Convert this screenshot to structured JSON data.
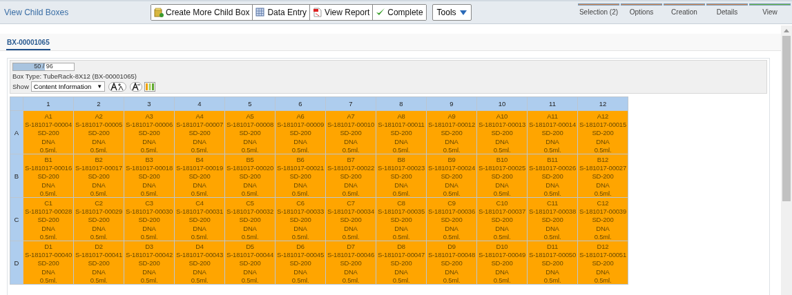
{
  "header": {
    "title": "View Child Boxes",
    "toolbar": [
      {
        "kind": "create",
        "label": "Create More Child Box"
      },
      {
        "kind": "entry",
        "label": "Data Entry"
      },
      {
        "kind": "report",
        "label": "View Report"
      },
      {
        "kind": "complete",
        "label": "Complete"
      }
    ],
    "tools": {
      "label": "Tools"
    },
    "steps": [
      {
        "label": "Selection (2)",
        "color": "#d9854a"
      },
      {
        "label": "Options",
        "color": "#d9854a"
      },
      {
        "label": "Creation",
        "color": "#d9854a"
      },
      {
        "label": "Details",
        "color": "#d9854a"
      },
      {
        "label": "View",
        "color": "#66bb44"
      }
    ]
  },
  "tabs": [
    {
      "label": "BX-00001065",
      "selected": true
    }
  ],
  "box": {
    "fill": {
      "level": 0.52,
      "reading": "50 / 96"
    },
    "box_type": "Box Type: TubeRack-8X12 (BX-00001065)",
    "show_label": "Show",
    "show_value": "Content Information",
    "show_arrow": "▼"
  },
  "grid": {
    "columns": [
      "1",
      "2",
      "3",
      "4",
      "5",
      "6",
      "7",
      "8",
      "9",
      "10",
      "11",
      "12"
    ],
    "rows": [
      {
        "label": "A",
        "cells": [
          [
            "A1",
            "S-181017-00004",
            "SD-200",
            "DNA",
            "0.5ml."
          ],
          [
            "A2",
            "S-181017-00005",
            "SD-200",
            "DNA",
            "0.5ml."
          ],
          [
            "A3",
            "S-181017-00006",
            "SD-200",
            "DNA",
            "0.5ml."
          ],
          [
            "A4",
            "S-181017-00007",
            "SD-200",
            "DNA",
            "0.5ml."
          ],
          [
            "A5",
            "S-181017-00008",
            "SD-200",
            "DNA",
            "0.5ml."
          ],
          [
            "A6",
            "S-181017-00009",
            "SD-200",
            "DNA",
            "0.5ml."
          ],
          [
            "A7",
            "S-181017-00010",
            "SD-200",
            "DNA",
            "0.5ml."
          ],
          [
            "A8",
            "S-181017-00011",
            "SD-200",
            "DNA",
            "0.5ml."
          ],
          [
            "A9",
            "S-181017-00012",
            "SD-200",
            "DNA",
            "0.5ml."
          ],
          [
            "A10",
            "S-181017-00013",
            "SD-200",
            "DNA",
            "0.5ml."
          ],
          [
            "A11",
            "S-181017-00014",
            "SD-200",
            "DNA",
            "0.5ml."
          ],
          [
            "A12",
            "S-181017-00015",
            "SD-200",
            "DNA",
            "0.5ml."
          ]
        ]
      },
      {
        "label": "B",
        "cells": [
          [
            "B1",
            "S-181017-00016",
            "SD-200",
            "DNA",
            "0.5ml."
          ],
          [
            "B2",
            "S-181017-00017",
            "SD-200",
            "DNA",
            "0.5ml."
          ],
          [
            "B3",
            "S-181017-00018",
            "SD-200",
            "DNA",
            "0.5ml."
          ],
          [
            "B4",
            "S-181017-00019",
            "SD-200",
            "DNA",
            "0.5ml."
          ],
          [
            "B5",
            "S-181017-00020",
            "SD-200",
            "DNA",
            "0.5ml."
          ],
          [
            "B6",
            "S-181017-00021",
            "SD-200",
            "DNA",
            "0.5ml."
          ],
          [
            "B7",
            "S-181017-00022",
            "SD-200",
            "DNA",
            "0.5ml."
          ],
          [
            "B8",
            "S-181017-00023",
            "SD-200",
            "DNA",
            "0.5ml."
          ],
          [
            "B9",
            "S-181017-00024",
            "SD-200",
            "DNA",
            "0.5ml."
          ],
          [
            "B10",
            "S-181017-00025",
            "SD-200",
            "DNA",
            "0.5ml."
          ],
          [
            "B11",
            "S-181017-00026",
            "SD-200",
            "DNA",
            "0.5ml."
          ],
          [
            "B12",
            "S-181017-00027",
            "SD-200",
            "DNA",
            "0.5ml."
          ]
        ]
      },
      {
        "label": "C",
        "cells": [
          [
            "C1",
            "S-181017-00028",
            "SD-200",
            "DNA",
            "0.5ml."
          ],
          [
            "C2",
            "S-181017-00029",
            "SD-200",
            "DNA",
            "0.5ml."
          ],
          [
            "C3",
            "S-181017-00030",
            "SD-200",
            "DNA",
            "0.5ml."
          ],
          [
            "C4",
            "S-181017-00031",
            "SD-200",
            "DNA",
            "0.5ml."
          ],
          [
            "C5",
            "S-181017-00032",
            "SD-200",
            "DNA",
            "0.5ml."
          ],
          [
            "C6",
            "S-181017-00033",
            "SD-200",
            "DNA",
            "0.5ml."
          ],
          [
            "C7",
            "S-181017-00034",
            "SD-200",
            "DNA",
            "0.5ml."
          ],
          [
            "C8",
            "S-181017-00035",
            "SD-200",
            "DNA",
            "0.5ml."
          ],
          [
            "C9",
            "S-181017-00036",
            "SD-200",
            "DNA",
            "0.5ml."
          ],
          [
            "C10",
            "S-181017-00037",
            "SD-200",
            "DNA",
            "0.5ml."
          ],
          [
            "C11",
            "S-181017-00038",
            "SD-200",
            "DNA",
            "0.5ml."
          ],
          [
            "C12",
            "S-181017-00039",
            "SD-200",
            "DNA",
            "0.5ml."
          ]
        ]
      },
      {
        "label": "D",
        "cells": [
          [
            "D1",
            "S-181017-00040",
            "SD-200",
            "DNA",
            "0.5ml."
          ],
          [
            "D2",
            "S-181017-00041",
            "SD-200",
            "DNA",
            "0.5ml."
          ],
          [
            "D3",
            "S-181017-00042",
            "SD-200",
            "DNA",
            "0.5ml."
          ],
          [
            "D4",
            "S-181017-00043",
            "SD-200",
            "DNA",
            "0.5ml."
          ],
          [
            "D5",
            "S-181017-00044",
            "SD-200",
            "DNA",
            "0.5ml."
          ],
          [
            "D6",
            "S-181017-00045",
            "SD-200",
            "DNA",
            "0.5ml."
          ],
          [
            "D7",
            "S-181017-00046",
            "SD-200",
            "DNA",
            "0.5ml."
          ],
          [
            "D8",
            "S-181017-00047",
            "SD-200",
            "DNA",
            "0.5ml."
          ],
          [
            "D9",
            "S-181017-00048",
            "SD-200",
            "DNA",
            "0.5ml."
          ],
          [
            "D10",
            "S-181017-00049",
            "SD-200",
            "DNA",
            "0.5ml."
          ],
          [
            "D11",
            "S-181017-00050",
            "SD-200",
            "DNA",
            "0.5ml."
          ],
          [
            "D12",
            "S-181017-00051",
            "SD-200",
            "DNA",
            "0.5ml."
          ]
        ]
      }
    ]
  }
}
